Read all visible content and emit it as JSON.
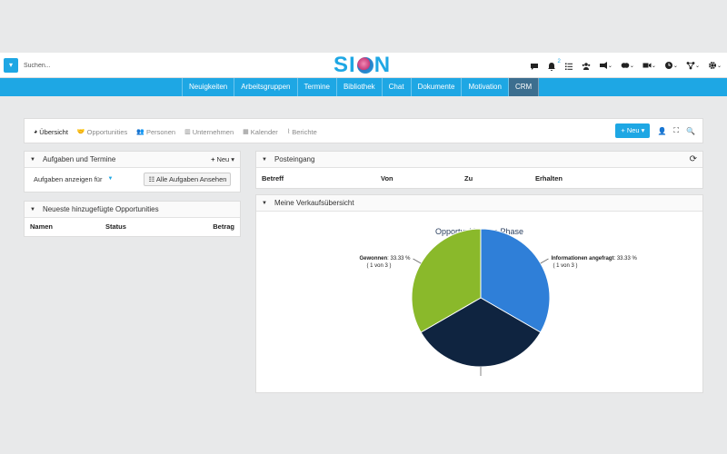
{
  "search": {
    "placeholder": "Suchen..."
  },
  "logo": {
    "text_left": "SI",
    "text_right": "N"
  },
  "notifications": {
    "count": "2"
  },
  "nav": {
    "items": [
      "Neuigkeiten",
      "Arbeitsgruppen",
      "Termine",
      "Bibliothek",
      "Chat",
      "Dokumente",
      "Motivation",
      "CRM"
    ],
    "active": "CRM"
  },
  "crm": {
    "tabs": [
      {
        "label": "Übersicht",
        "icon": "dashboard-icon"
      },
      {
        "label": "Opportunities",
        "icon": "handshake-icon"
      },
      {
        "label": "Personen",
        "icon": "people-icon"
      },
      {
        "label": "Unternehmen",
        "icon": "building-icon"
      },
      {
        "label": "Kalender",
        "icon": "calendar-icon"
      },
      {
        "label": "Berichte",
        "icon": "chart-icon"
      }
    ],
    "new_label": "Neu"
  },
  "tasks": {
    "title": "Aufgaben und Termine",
    "new_label": "Neu",
    "show_for_label": "Aufgaben anzeigen für",
    "all_label": "Alle Aufgaben Ansehen"
  },
  "opportunities": {
    "title": "Neueste hinzugefügte Opportunities",
    "columns": [
      "Namen",
      "Status",
      "Betrag"
    ]
  },
  "inbox": {
    "title": "Posteingang",
    "columns": [
      "Betreff",
      "Von",
      "Zu",
      "Erhalten"
    ]
  },
  "sales": {
    "title": "Meine Verkaufsübersicht"
  },
  "chart_data": {
    "type": "pie",
    "title": "Opportunities pro Phase",
    "slices": [
      {
        "name": "Informationen angefragt",
        "value": 33.33,
        "pct_label": ": 33.33 %",
        "count_label": "( 1 von 3 )",
        "color": "#2f7fd8"
      },
      {
        "name": "",
        "value": 33.33,
        "color": "#0f2440"
      },
      {
        "name": "Gewonnen",
        "value": 33.33,
        "pct_label": ": 33.33 %",
        "count_label": "( 1 von 3 )",
        "color": "#8ab92b"
      }
    ]
  }
}
